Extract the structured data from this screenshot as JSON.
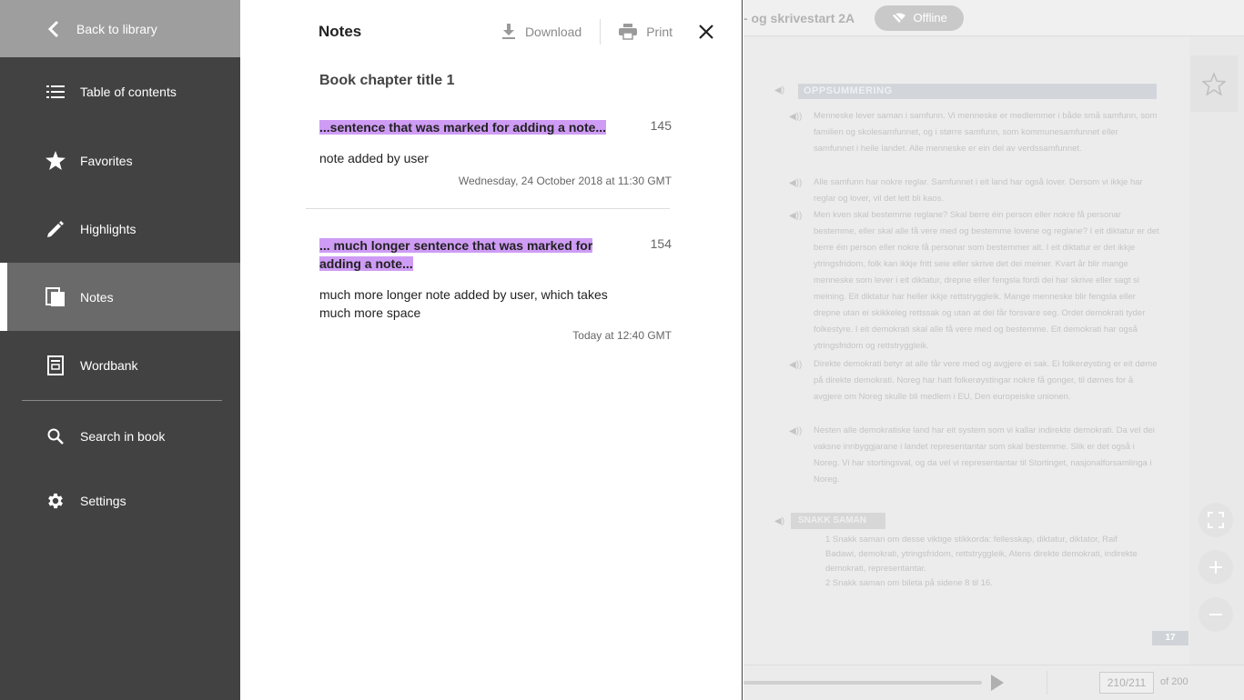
{
  "sidebar": {
    "back_label": "Back to library",
    "items": [
      {
        "label": "Table of contents",
        "icon": "list-icon"
      },
      {
        "label": "Favorites",
        "icon": "star-icon"
      },
      {
        "label": "Highlights",
        "icon": "pencil-icon"
      },
      {
        "label": "Notes",
        "icon": "notes-icon",
        "active": true
      },
      {
        "label": "Wordbank",
        "icon": "wordbank-icon"
      },
      {
        "label": "Search in book",
        "icon": "search-icon"
      },
      {
        "label": "Settings",
        "icon": "gear-icon"
      }
    ]
  },
  "notes_panel": {
    "title": "Notes",
    "download_label": "Download",
    "print_label": "Print",
    "chapter_title": "Book chapter title 1",
    "notes": [
      {
        "quote": "...sentence that was marked for adding a note...",
        "page": "145",
        "text": "note added by user",
        "date": "Wednesday, 24 October 2018 at 11:30 GMT"
      },
      {
        "quote": "... much longer sentence that was marked for adding a note...",
        "page": "154",
        "text": "much more longer note added by user, which takes much more space",
        "date": "Today at 12:40 GMT"
      }
    ]
  },
  "reader": {
    "book_title": "- og skrivestart 2A",
    "offline_label": "Offline",
    "banner": "OPPSUMMERING",
    "paragraphs": [
      "Menneske lever saman i samfunn. Vi menneske er medlemmer i både små samfunn, som familien og skolesamfunnet, og i større samfunn, som kommunesamfunnet eller samfunnet i heile landet. Alle menneske er ein del av verdssamfunnet.",
      "Alle samfunn har nokre reglar. Samfunnet i eit land har også lover. Dersom vi ikkje har reglar og lover, vil det lett bli kaos.",
      "Men kven skal bestemme reglane? Skal berre éin person eller nokre få personar bestemme, eller skal alle få vere med og bestemme lovene og reglane? I eit diktatur er det berre éin person eller nokre få personar som bestemmer alt. I eit diktatur er det ikkje ytringsfridom, folk kan ikkje fritt seie eller skrive det dei meiner. Kvart år blir mange menneske som lever i eit diktatur, drepne eller fengsla fordi dei har skrive eller sagt si meining. Eit diktatur har heller ikkje rettstryggleik. Mange menneske blir fengsla eller drepne utan ei skikkeleg rettssak og utan at dei får forsvare seg. Ordet demokrati tyder folkestyre. I eit demokrati skal alle få vere med og bestemme. Eit demokrati har også ytringsfridom og rettstryggleik.",
      "Direkte demokrati betyr at alle får vere med og avgjere ei sak. Ei folkerøysting er eit døme på direkte demokrati. Noreg har hatt folkerøystingar nokre få gonger, til dømes for å avgjere om Noreg skulle bli medlem i EU, Den europeiske unionen.",
      "Nesten alle demokratiske land har eit system som vi kallar indirekte demokrati. Da vel dei vaksne innbyggjarane i landet representantar som skal bestemme. Slik er det også i Noreg. Vi har stortingsval, og da vel vi representantar til Stortinget, nasjonalforsamlinga i Noreg."
    ],
    "snakk_header": "SNAKK SAMAN",
    "snakk_items": [
      "1  Snakk saman om desse viktige stikkorda: fellesskap, diktatur, diktator, Raif Badawi, demokrati, ytringsfridom, rettstryggleik, Atens direkte demokrati, indirekte demokrati, representantar.",
      "2  Snakk saman om bileta på sidene 8 til 16."
    ],
    "page_tag": "17",
    "page_input": "210/211",
    "page_of": "of 200"
  }
}
